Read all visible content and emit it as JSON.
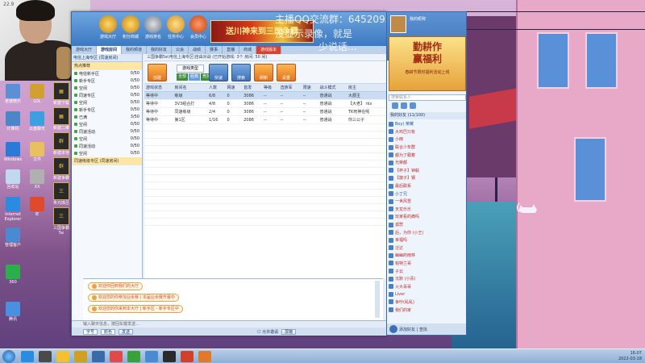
{
  "webcam": {
    "watermark": "22.9"
  },
  "overlay": {
    "line1": "主播QQ交流群：64520955",
    "line2": "没显示录像，就是",
    "line3": "少说话..."
  },
  "desktop_icons": [
    {
      "label": "老婆微乐",
      "color": "#5b8fd6"
    },
    {
      "label": "LOL",
      "color": "#d0a030"
    },
    {
      "label": "计算机",
      "color": "#4a86c8"
    },
    {
      "label": "云盘聊天",
      "color": "#3ca0e0"
    },
    {
      "label": "Windows",
      "color": "#2b7ad8"
    },
    {
      "label": "文件",
      "color": "#e8c060"
    },
    {
      "label": "回收站",
      "color": "#c0d8f0"
    },
    {
      "label": "XX",
      "color": "#b0b0b0"
    },
    {
      "label": "Internet Explorer",
      "color": "#2a8ce0"
    },
    {
      "label": "IE",
      "color": "#e04a2a"
    },
    {
      "label": "管理客户",
      "color": "#4a8ad0"
    },
    {
      "label": "360",
      "color": "#2ab04a"
    },
    {
      "label": "腾讯",
      "color": "#4a90e0"
    }
  ],
  "side_icons": [
    {
      "label": "新建下载",
      "glyph": "▦"
    },
    {
      "label": "新建二维",
      "glyph": "▦"
    },
    {
      "label": "新建本地",
      "glyph": "群"
    },
    {
      "label": "新建争霸",
      "glyph": "群"
    },
    {
      "label": "朱元璋吕",
      "glyph": "三"
    },
    {
      "label": "三国争霸5e",
      "glyph": "三"
    }
  ],
  "ribbon": {
    "buttons": [
      "游戏大厅",
      "积分商城",
      "游戏排名",
      "任务中心",
      "会员中心"
    ],
    "banner": "送川神来到三国争霸"
  },
  "tabs": [
    {
      "label": "游戏大厅",
      "active": false
    },
    {
      "label": "游戏房间",
      "active": true
    },
    {
      "label": "我的频道",
      "active": false
    },
    {
      "label": "我的好友",
      "active": false
    },
    {
      "label": "公会",
      "active": false
    },
    {
      "label": "战绩",
      "active": false
    },
    {
      "label": "赛事",
      "active": false
    },
    {
      "label": "直播",
      "active": false
    },
    {
      "label": "商城",
      "active": false
    },
    {
      "label": "游戏版本",
      "active": false,
      "red": true
    }
  ],
  "left_pane": {
    "header": "电信上海专区 (同速房间)",
    "hot": "热点推荐",
    "rows": [
      {
        "name": "电信新手区",
        "count": "0",
        "cap": "50"
      },
      {
        "name": "新手专区",
        "count": "0",
        "cap": "50"
      },
      {
        "name": "空闲",
        "count": "0",
        "cap": "50"
      },
      {
        "name": "同速专区",
        "count": "0",
        "cap": "50"
      },
      {
        "name": "空闲",
        "count": "0",
        "cap": "50"
      },
      {
        "name": "新手专区",
        "count": "0",
        "cap": "50"
      },
      {
        "name": "已满",
        "count": "3",
        "cap": "50"
      },
      {
        "name": "空闲",
        "count": "0",
        "cap": "50"
      },
      {
        "name": "同速活动",
        "count": "0",
        "cap": "50"
      },
      {
        "name": "空闲",
        "count": "0",
        "cap": "50"
      },
      {
        "name": "同速活动",
        "count": "0",
        "cap": "50"
      },
      {
        "name": "空闲",
        "count": "0",
        "cap": "50"
      }
    ],
    "selected_label": "同速练级专区 (同速房间)"
  },
  "right_pane": {
    "path": "三国争霸5e\\电信上海专区\\自由对战 (已开始游戏: 3个 房间: 50 间)",
    "tools": [
      "创建",
      "快速",
      "搜索",
      "刷新",
      "设置"
    ],
    "mode_label": "游戏类型",
    "modes": [
      "全部",
      "经典",
      "竞技"
    ],
    "columns": [
      "游戏状态",
      "房间名",
      "人数",
      "网速",
      "首发",
      "等级",
      "选族军",
      "限速",
      "战斗模式",
      "房主"
    ],
    "rows": [
      {
        "status": "等待中",
        "name": "练级",
        "players": "6/8",
        "ping": "0",
        "first": "3086",
        "level": "--",
        "race": "--",
        "limit": "--",
        "mode": "普通战",
        "host": "大郡主"
      },
      {
        "status": "等待中",
        "name": "3V3组合打",
        "players": "4/8",
        "ping": "0",
        "first": "3086",
        "level": "--",
        "race": "--",
        "limit": "--",
        "mode": "普通战",
        "host": "【大老】 rks"
      },
      {
        "status": "等待中",
        "name": "同速练级",
        "players": "2/4",
        "ping": "0",
        "first": "3086",
        "level": "--",
        "race": "--",
        "limit": "--",
        "mode": "普通战",
        "host": "TK死神在呢"
      },
      {
        "status": "等待中",
        "name": "第1区",
        "players": "1/16",
        "ping": "0",
        "first": "2086",
        "level": "--",
        "race": "--",
        "limit": "--",
        "mode": "普通战",
        "host": "你三公子"
      }
    ]
  },
  "chat": {
    "lines": [
      "欢迎你回到我们的大厅",
      "欢迎您的你参加业余赛 | 本届业余赛开幕中",
      "欢迎您的你来到本大厅 | 新手区 - 新手专区中"
    ]
  },
  "input_bar": {
    "placeholder": "输入聊天信息，按回车键发送..."
  },
  "bottom_bar": {
    "size_select": "字号",
    "color_select": "颜色",
    "send": "发送",
    "checkbox": "允许邀请",
    "extra": "屏蔽"
  },
  "friends": {
    "username": "我的昵称",
    "ad_line1": "勤耕作",
    "ad_line2": "赢福利",
    "ad_small": "春耕节限时福利活动上线",
    "search_placeholder": "搜索联系人",
    "header": "我的好友 (11/100)",
    "items": [
      {
        "name": "Boy) 荣耀",
        "color": "blue"
      },
      {
        "name": "大鸡巴只有",
        "color": "red"
      },
      {
        "name": "小雨",
        "color": "red"
      },
      {
        "name": "联合少年群",
        "color": "red"
      },
      {
        "name": "都为了跟着",
        "color": "red"
      },
      {
        "name": "光荣都",
        "color": "red"
      },
      {
        "name": "【杯子】钟毅",
        "color": "red"
      },
      {
        "name": "【旗子】钢",
        "color": "red"
      },
      {
        "name": "最后联系",
        "color": "red"
      },
      {
        "name": "小丁兄",
        "color": "blue"
      },
      {
        "name": "一世风雪",
        "color": "red"
      },
      {
        "name": "天龙乐乐",
        "color": "red"
      },
      {
        "name": "玩家看的痛吗",
        "color": "red"
      },
      {
        "name": "孤悲",
        "color": "red"
      },
      {
        "name": "后，为你 (小王)",
        "color": "red"
      },
      {
        "name": "幸福吗",
        "color": "red"
      },
      {
        "name": "泛达",
        "color": "red"
      },
      {
        "name": "幽幽的雨林",
        "color": "red"
      },
      {
        "name": "帕特兰哥",
        "color": "red"
      },
      {
        "name": "子云",
        "color": "red"
      },
      {
        "name": "沉默 (小青)",
        "color": "red"
      },
      {
        "name": "火大哥哥",
        "color": "red"
      },
      {
        "name": "Liver",
        "color": "red"
      },
      {
        "name": "争吵(乱乱)",
        "color": "red"
      },
      {
        "name": "我们的家",
        "color": "red"
      }
    ],
    "footer": "添加好友 | 查找"
  },
  "taskbar": {
    "apps": [
      "#2a8ce0",
      "#4a4a4a",
      "#f2c030",
      "#d0a020",
      "#3a6aa8",
      "#e04a4a",
      "#3aa03a",
      "#4a8ad0",
      "#2a2a2a",
      "#d0402a",
      "#e07a2a"
    ],
    "time": "16:07",
    "date": "2022-03-18"
  }
}
